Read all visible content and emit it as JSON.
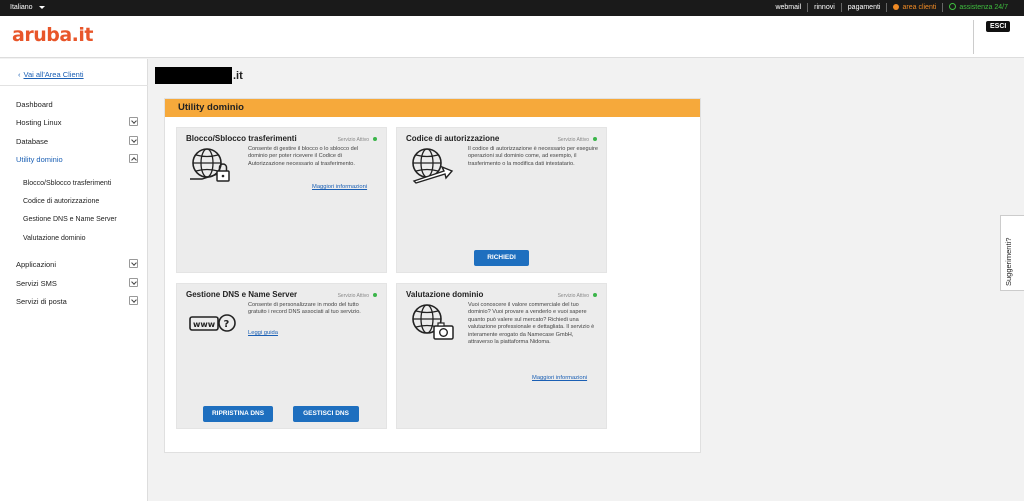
{
  "topbar": {
    "language": "Italiano",
    "links": [
      "webmail",
      "rinnovi",
      "pagamenti"
    ],
    "area_clienti": "area clienti",
    "assistenza": "assistenza 24/7",
    "colors": {
      "area_clienti": "#f08a24",
      "assistenza": "#3fbf3f"
    }
  },
  "header": {
    "logo": "aruba.it",
    "logout": "ESCI",
    "brand_color": "#e8562a"
  },
  "sidebar": {
    "back_link": "Vai all'Area Clienti",
    "items": [
      {
        "label": "Dashboard"
      },
      {
        "label": "Hosting Linux"
      },
      {
        "label": "Database"
      },
      {
        "label": "Utility dominio",
        "active": true
      },
      {
        "label": "Applicazioni"
      },
      {
        "label": "Servizi SMS"
      },
      {
        "label": "Servizi di posta"
      }
    ],
    "subitems": [
      "Blocco/Sblocco trasferimenti",
      "Codice di autorizzazione",
      "Gestione DNS e Name Server",
      "Valutazione dominio"
    ]
  },
  "main": {
    "domain_suffix": ".it",
    "panel_title": "Utility dominio",
    "accent_color": "#f6a93b",
    "cards": [
      {
        "title": "Blocco/Sblocco trasferimenti",
        "status": "Servizio Attivo",
        "description": "Consente di gestire il blocco o lo sblocco del dominio per poter ricevere il Codice di Autorizzazione necessario al trasferimento.",
        "link": "Maggiori informazioni",
        "icon": "globe-lock-icon"
      },
      {
        "title": "Codice di autorizzazione",
        "status": "Servizio Attivo",
        "description": "Il codice di autorizzazione è necessario per eseguire operazioni sul dominio come, ad esempio, il trasferimento o la modifica dati intestatario.",
        "button": "RICHIEDI",
        "icon": "globe-transfer-icon"
      },
      {
        "title": "Gestione DNS e Name Server",
        "status": "Servizio Attivo",
        "description": "Consente di personalizzare in modo del tutto gratuito i record DNS associati al tuo servizio.",
        "link": "Leggi guida",
        "buttons": [
          "RIPRISTINA DNS",
          "GESTISCI DNS"
        ],
        "icon": "www-question-icon"
      },
      {
        "title": "Valutazione dominio",
        "status": "Servizio Attivo",
        "description": "Vuoi conoscere il valore commerciale del tuo dominio? Vuoi provare a venderlo e vuoi sapere quanto può valere sul mercato? Richiedi una valutazione professionale e dettagliata. Il servizio è interamente erogato da Namecase GmbH, attraverso la piattaforma Nidoma.",
        "link": "Maggiori informazioni",
        "icon": "globe-camera-icon"
      }
    ],
    "button_color": "#1e6fbf",
    "status_color": "#3bb54a"
  },
  "feedback": "Suggerimenti?"
}
